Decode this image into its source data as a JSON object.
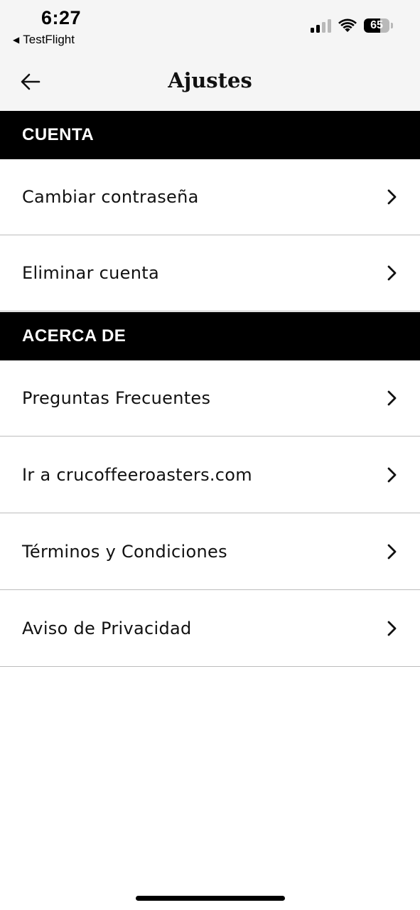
{
  "status_bar": {
    "time": "6:27",
    "back_app_label": "TestFlight",
    "back_app_icon": "back-triangle-icon",
    "signal_bars_active": 2,
    "signal_bars_total": 4,
    "wifi_icon": "wifi-icon",
    "battery_percent": 65,
    "battery_label": "65"
  },
  "header": {
    "title": "Ajustes",
    "back_icon": "arrow-left-icon"
  },
  "sections": [
    {
      "title": "CUENTA",
      "items": [
        {
          "label": "Cambiar contraseña",
          "icon": "chevron-right-icon"
        },
        {
          "label": "Eliminar cuenta",
          "icon": "chevron-right-icon"
        }
      ]
    },
    {
      "title": "ACERCA DE",
      "items": [
        {
          "label": "Preguntas Frecuentes",
          "icon": "chevron-right-icon"
        },
        {
          "label": "Ir a crucoffeeroasters.com",
          "icon": "chevron-right-icon"
        },
        {
          "label": "Términos y Condiciones",
          "icon": "chevron-right-icon"
        },
        {
          "label": "Aviso de Privacidad",
          "icon": "chevron-right-icon"
        }
      ]
    }
  ],
  "colors": {
    "section_header_bg": "#000000",
    "section_header_text": "#ffffff",
    "header_bg": "#f5f5f5",
    "divider": "#bdbdbd"
  }
}
